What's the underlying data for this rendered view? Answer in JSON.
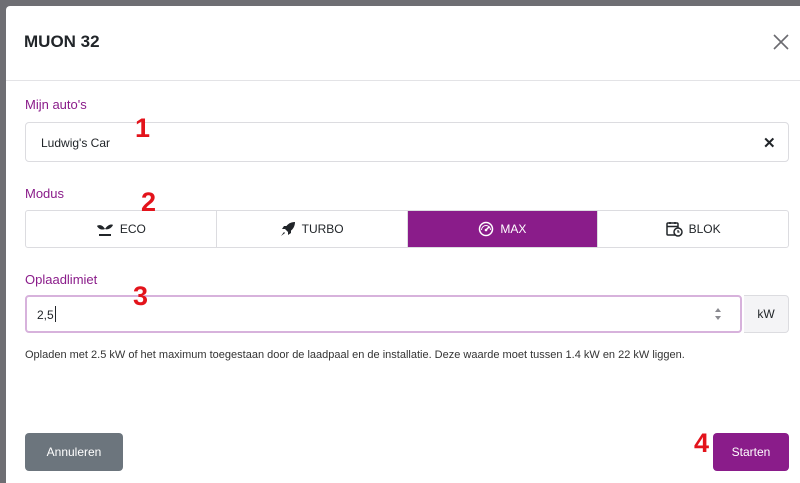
{
  "dialog": {
    "title": "MUON 32",
    "close_icon": "close-icon"
  },
  "car": {
    "label": "Mijn auto's",
    "value": "Ludwig's Car",
    "clear_icon": "clear-icon"
  },
  "mode": {
    "label": "Modus",
    "options": [
      {
        "label": "ECO",
        "icon": "seedling-icon",
        "active": false
      },
      {
        "label": "TURBO",
        "icon": "rocket-icon",
        "active": false
      },
      {
        "label": "MAX",
        "icon": "gauge-icon",
        "active": true
      },
      {
        "label": "BLOK",
        "icon": "calendar-clock-icon",
        "active": false
      }
    ],
    "active_color": "#8a1c8a"
  },
  "limit": {
    "label": "Oplaadlimiet",
    "value": "2,5",
    "unit": "kW",
    "help_text": "Opladen met 2.5 kW of het maximum toegestaan door de laadpaal en de installatie. Deze waarde moet tussen 1.4 kW en 22 kW liggen."
  },
  "actions": {
    "cancel_label": "Annuleren",
    "start_label": "Starten"
  },
  "annotations": [
    "1",
    "2",
    "3",
    "4"
  ],
  "colors": {
    "accent": "#8a1c8a",
    "cancel": "#6c757d",
    "annotation": "#e3131b"
  }
}
